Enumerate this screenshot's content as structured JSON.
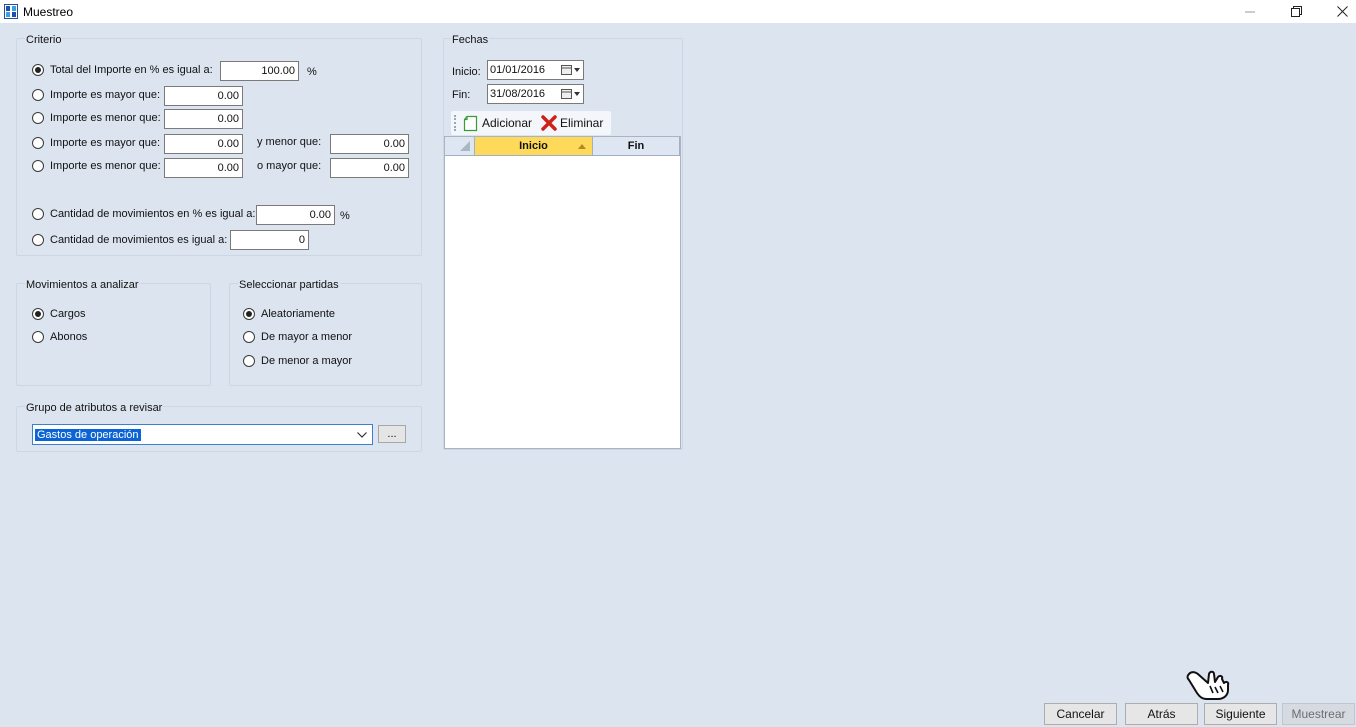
{
  "window": {
    "title": "Muestreo",
    "controls": [
      "minimize-icon",
      "restore-icon",
      "close-icon"
    ]
  },
  "criterio": {
    "title": "Criterio",
    "total_importe": {
      "label": "Total del Importe en %  es igual a:",
      "value": "100.00",
      "unit": "%",
      "checked": true
    },
    "mayor": {
      "label": "Importe es mayor que:",
      "value": "0.00"
    },
    "menor": {
      "label": "Importe es menor que:",
      "value": "0.00"
    },
    "rango1": {
      "label": "Importe es mayor que:",
      "value": "0.00",
      "label2": "y menor que:",
      "value2": "0.00"
    },
    "rango2": {
      "label": "Importe es menor que:",
      "value": "0.00",
      "label2": "o mayor que:",
      "value2": "0.00"
    },
    "cant_pct": {
      "label": "Cantidad de movimientos en % es igual a:",
      "value": "0.00",
      "unit": "%"
    },
    "cant": {
      "label": "Cantidad de movimientos es igual a:",
      "value": "0"
    }
  },
  "movimientos": {
    "title": "Movimientos a analizar",
    "options": [
      "Cargos",
      "Abonos"
    ],
    "selected": "Cargos"
  },
  "partidas": {
    "title": "Seleccionar partidas",
    "options": [
      "Aleatoriamente",
      "De mayor a menor",
      "De menor a mayor"
    ],
    "selected": "Aleatoriamente"
  },
  "grupo": {
    "title": "Grupo de atributos a revisar",
    "selected": "Gastos de operación",
    "button": "..."
  },
  "fechas": {
    "title": "Fechas",
    "inicio_label": "Inicio:",
    "inicio_value": "01/01/2016",
    "fin_label": "Fin:",
    "fin_value": "31/08/2016",
    "toolbar": {
      "add": "Adicionar",
      "delete": "Eliminar"
    },
    "columns": [
      "Inicio",
      "Fin"
    ],
    "rows": []
  },
  "buttons": {
    "cancel": "Cancelar",
    "back": "Atrás",
    "next": "Siguiente",
    "sample": "Muestrear"
  },
  "colors": {
    "background": "#dbe4ef",
    "sorted_header": "#ffd95a",
    "selection": "#0a64d6"
  }
}
